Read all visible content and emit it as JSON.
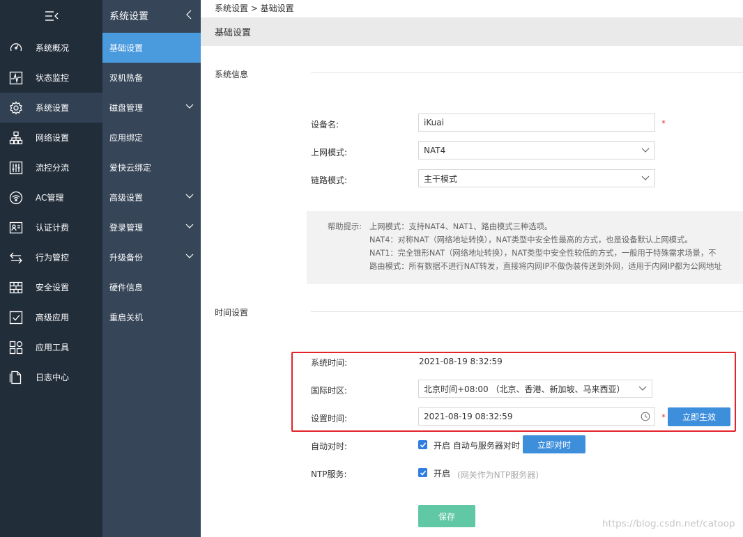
{
  "colors": {
    "sidebar_bg": "#222d3a",
    "submenu_bg": "#364558",
    "active_blue": "#4a9ade",
    "button_blue": "#3e8fdb",
    "save_green": "#60c8a4",
    "highlight_red": "#e4232a"
  },
  "sidebar": {
    "menu_icon": "hamburger-collapse-icon",
    "items": [
      {
        "label": "系统概况",
        "icon": "dashboard-icon"
      },
      {
        "label": "状态监控",
        "icon": "monitor-icon"
      },
      {
        "label": "系统设置",
        "icon": "gear-icon"
      },
      {
        "label": "网络设置",
        "icon": "network-icon"
      },
      {
        "label": "流控分流",
        "icon": "sliders-icon"
      },
      {
        "label": "AC管理",
        "icon": "wifi-icon"
      },
      {
        "label": "认证计费",
        "icon": "id-card-icon"
      },
      {
        "label": "行为管控",
        "icon": "arrows-icon"
      },
      {
        "label": "安全设置",
        "icon": "firewall-icon"
      },
      {
        "label": "高级应用",
        "icon": "check-box-icon"
      },
      {
        "label": "应用工具",
        "icon": "tools-grid-icon"
      },
      {
        "label": "日志中心",
        "icon": "document-icon"
      }
    ]
  },
  "submenu": {
    "title": "系统设置",
    "items": [
      {
        "label": "基础设置"
      },
      {
        "label": "双机热备"
      },
      {
        "label": "磁盘管理"
      },
      {
        "label": "应用绑定"
      },
      {
        "label": "爱快云绑定"
      },
      {
        "label": "高级设置"
      },
      {
        "label": "登录管理"
      },
      {
        "label": "升级备份"
      },
      {
        "label": "硬件信息"
      },
      {
        "label": "重启关机"
      }
    ]
  },
  "main": {
    "breadcrumb": "系统设置 > 基础设置",
    "page_title": "基础设置",
    "system_info": {
      "section_title": "系统信息",
      "device_name_label": "设备名:",
      "device_name_value": "iKuai",
      "uplink_mode_label": "上网模式:",
      "uplink_mode_value": "NAT4",
      "link_mode_label": "链路模式:",
      "link_mode_value": "主干模式",
      "required_mark": "*"
    },
    "help": {
      "prefix": "帮助提示:",
      "line1": "上网模式：支持NAT4、NAT1、路由模式三种选项。",
      "line2": "NAT4：对称NAT（网络地址转换），NAT类型中安全性最高的方式，也是设备默认上网模式。",
      "line3": "NAT1：完全锥形NAT（网络地址转换），NAT类型中安全性较低的方式，一般用于特殊需求场景，不",
      "line4": "路由模式：所有数据不进行NAT转发，直接将内网IP不做伪装传送到外网，适用于内网IP都为公网地址"
    },
    "time": {
      "section_title": "时间设置",
      "system_time_label": "系统时间:",
      "system_time_value": "2021-08-19 8:32:59",
      "timezone_label": "国际时区:",
      "timezone_value": "北京时间+08:00 （北京、香港、新加坡、马来西亚）",
      "set_time_label": "设置时间:",
      "set_time_value": "2021-08-19 08:32:59",
      "apply_now_button": "立即生效",
      "auto_sync_label": "自动对时:",
      "auto_sync_text": "开启 自动与服务器对时",
      "sync_now_button": "立即对时",
      "ntp_label": "NTP服务:",
      "ntp_text": "开启",
      "ntp_hint": "(网关作为NTP服务器)",
      "required_mark": "*"
    },
    "save_button": "保存",
    "watermark": "https://blog.csdn.net/catoop"
  }
}
